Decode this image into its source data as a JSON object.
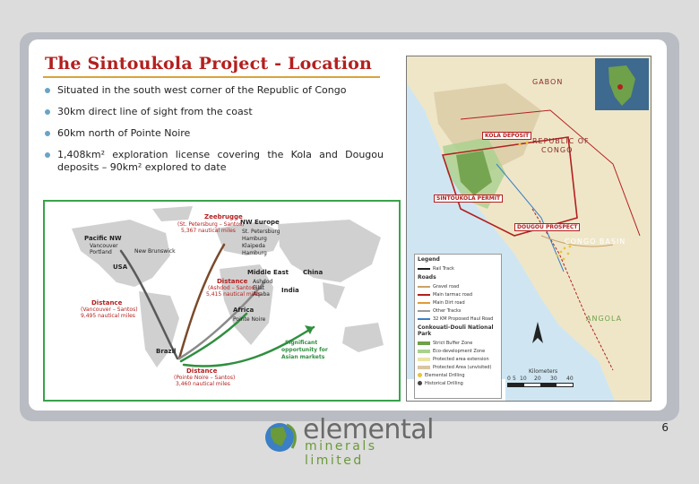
{
  "slide": {
    "title": "The Sintoukola Project - Location",
    "bullets": [
      "Situated in the south west corner of the Republic of Congo",
      "30km direct line of sight from the coast",
      "60km north of Pointe Noire",
      "1,408km² exploration license covering the Kola and Dougou deposits – 90km² explored to date"
    ],
    "page_number": "6"
  },
  "world_map": {
    "labels": {
      "nw_europe": "NW Europe",
      "zeebrugge": "Zeebrugge",
      "zeebrugge_dist": "(St. Petersburg – Santos)",
      "zeebrugge_nm": "5,367 nautical miles",
      "europe_ports": [
        "St. Petersburg",
        "Hamburg",
        "Klaipeda",
        "Hamburg"
      ],
      "pacific_nw": "Pacific NW",
      "pacific_ports": [
        "Vancouver",
        "Portland"
      ],
      "new_brunswick": "New Brunswick",
      "usa": "USA",
      "middle_east": "Middle East",
      "me_ports": [
        "Ashdod",
        "Eilat",
        "Aqaba"
      ],
      "china": "China",
      "india": "India",
      "distance_top": "Distance",
      "distance_top_route": "(Ashdod – Santos)",
      "distance_top_nm": "5,415 nautical miles",
      "distance_left": "Distance",
      "distance_left_route": "(Vancouver – Santos)",
      "distance_left_nm": "9,495 nautical miles",
      "africa": "Africa",
      "pointe_noire": "Pointe Noire",
      "brazil": "Brazil",
      "significant": "Significant",
      "opportunity": "opportunity for",
      "asian_markets": "Asian markets",
      "distance_bottom": "Distance",
      "distance_bottom_route": "(Pointe Noire – Santos)",
      "distance_bottom_nm": "3,460 nautical miles"
    }
  },
  "region_map": {
    "labels": {
      "gabon": "GABON",
      "republic_of_congo": "REPUBLIC OF",
      "congo": "CONGO",
      "kola_deposit": "KOLA DEPOSIT",
      "sintoukola_permit": "SINTOUKOLA PERMIT",
      "dougou_prospect": "DOUGOU PROSPECT",
      "congo_basin": "CONGO BASIN",
      "angola": "ANGOLA"
    },
    "legend": {
      "title": "Legend",
      "rail": "Rail Track",
      "roads_title": "Roads",
      "items": [
        {
          "label": "Gravel road",
          "color": "#c9a26b"
        },
        {
          "label": "Main tarmac road",
          "color": "#b3201f"
        },
        {
          "label": "Main Dirt road",
          "color": "#e09a3b"
        },
        {
          "label": "Other Tracks",
          "color": "#9a9a9a"
        },
        {
          "label": "32 KM Proposed Haul Road",
          "color": "#3b7fc4"
        }
      ],
      "park_title": "Conkouati-Douli National Park",
      "park_items": [
        {
          "label": "Strict Buffer Zone",
          "color": "#6fa04a"
        },
        {
          "label": "Eco-development Zone",
          "color": "#a9d18e"
        },
        {
          "label": "Protected area extension",
          "color": "#e9e3a5"
        },
        {
          "label": "Protected Area (unvisited)",
          "color": "#d8c6a0"
        },
        {
          "label": "Elemental Drilling",
          "color": "#e8c53a"
        },
        {
          "label": "Historical Drilling",
          "color": "#444444"
        }
      ],
      "kilometers": "Kilometers",
      "scale": [
        "0",
        "5",
        "10",
        "20",
        "30",
        "40"
      ]
    },
    "colors": {
      "ocean": "#cfe6f2",
      "land": "#efe6c8",
      "permit": "#b3201f",
      "park": "#6fa04a"
    }
  },
  "logo": {
    "word": "elemental",
    "sub": "minerals limited"
  }
}
